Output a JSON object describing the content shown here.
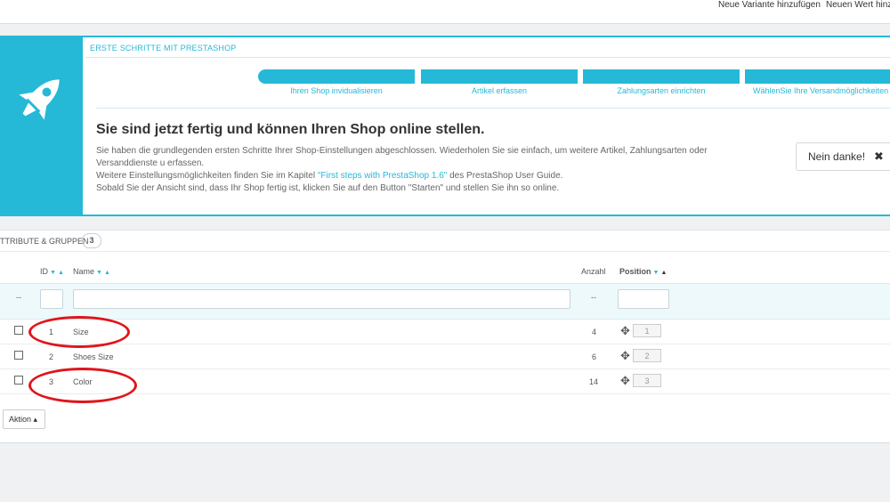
{
  "topbar": {
    "add_variant": "Neue Variante hinzufügen",
    "add_value": "Neuen Wert hinzu"
  },
  "onboarding": {
    "title": "ERSTE SCHRITTE MIT PRESTASHOP",
    "steps": [
      {
        "label": "Ihren Shop invidualisieren"
      },
      {
        "label": "Artikel erfassen"
      },
      {
        "label": "Zahlungsarten einrichten"
      },
      {
        "label": "WählenSie Ihre Versandmöglichkeiten"
      }
    ],
    "heading": "Sie sind jetzt fertig und können Ihren Shop online stellen.",
    "para1": "Sie haben die grundlegenden ersten Schritte Ihrer Shop-Einstellungen abgeschlossen. Wiederholen Sie sie einfach, um weitere Artikel, Zahlungsarten oder Versanddienste u erfassen.",
    "para2_before": "Weitere Einstellungsmöglichkeiten finden Sie im Kapitel ",
    "para2_link": "\"First steps with PrestaShop 1.6\"",
    "para2_after": " des PrestaShop User Guide.",
    "para3": "Sobald Sie der Ansicht sind, dass Ihr Shop fertig ist, klicken Sie auf den Button \"Starten\" und stellen Sie ihn so online.",
    "dismiss_label": "Nein danke!",
    "dismiss_icon": "✖"
  },
  "panel": {
    "title": "TTRIBUTE & GRUPPEN",
    "count": "3",
    "columns": {
      "id": "ID",
      "name": "Name",
      "count": "Anzahl",
      "position": "Position"
    },
    "sort_down": "▼",
    "sort_up": "▲",
    "filter_dash": "--",
    "rows": [
      {
        "id": "1",
        "name": "Size",
        "count": "4",
        "position": "1"
      },
      {
        "id": "2",
        "name": "Shoes Size",
        "count": "6",
        "position": "2"
      },
      {
        "id": "3",
        "name": "Color",
        "count": "14",
        "position": "3"
      }
    ],
    "bulk_action": "Aktion ▴"
  },
  "colors": {
    "accent": "#25b9d7",
    "annotation": "#e0151b"
  }
}
